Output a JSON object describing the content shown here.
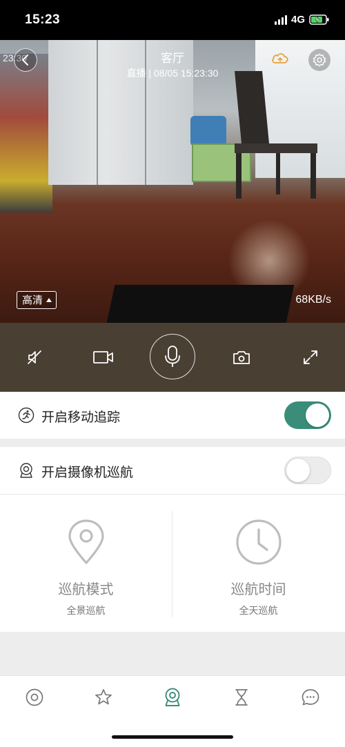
{
  "status_bar": {
    "time": "15:23",
    "network": "4G",
    "signal_bars": 4,
    "battery": "charging"
  },
  "video": {
    "title": "客厅",
    "subtitle": "直播 | 08/05 15:23:30",
    "overlay_timestamp": "23:30",
    "quality_label": "高清",
    "speed": "68KB/s"
  },
  "controls": {
    "items": [
      {
        "icon": "mute-icon"
      },
      {
        "icon": "record-video-icon"
      },
      {
        "icon": "microphone-icon"
      },
      {
        "icon": "camera-snapshot-icon"
      },
      {
        "icon": "fullscreen-icon"
      }
    ]
  },
  "settings": {
    "motion_tracking": {
      "label": "开启移动追踪",
      "enabled": true,
      "icon": "running-person-icon"
    },
    "camera_cruise": {
      "label": "开启摄像机巡航",
      "enabled": false,
      "icon": "webcam-icon"
    }
  },
  "cruise": {
    "mode": {
      "title": "巡航模式",
      "value": "全景巡航",
      "icon": "location-pin-icon"
    },
    "time": {
      "title": "巡航时间",
      "value": "全天巡航",
      "icon": "clock-icon"
    }
  },
  "tabbar": {
    "items": [
      {
        "icon": "target-icon",
        "active": false
      },
      {
        "icon": "star-icon",
        "active": false
      },
      {
        "icon": "webcam-icon",
        "active": true
      },
      {
        "icon": "hourglass-icon",
        "active": false
      },
      {
        "icon": "chat-bubble-icon",
        "active": false
      }
    ]
  },
  "colors": {
    "accent": "#3a8e79",
    "control_bar": "#4a3f33",
    "cloud_icon": "#e8a135"
  }
}
